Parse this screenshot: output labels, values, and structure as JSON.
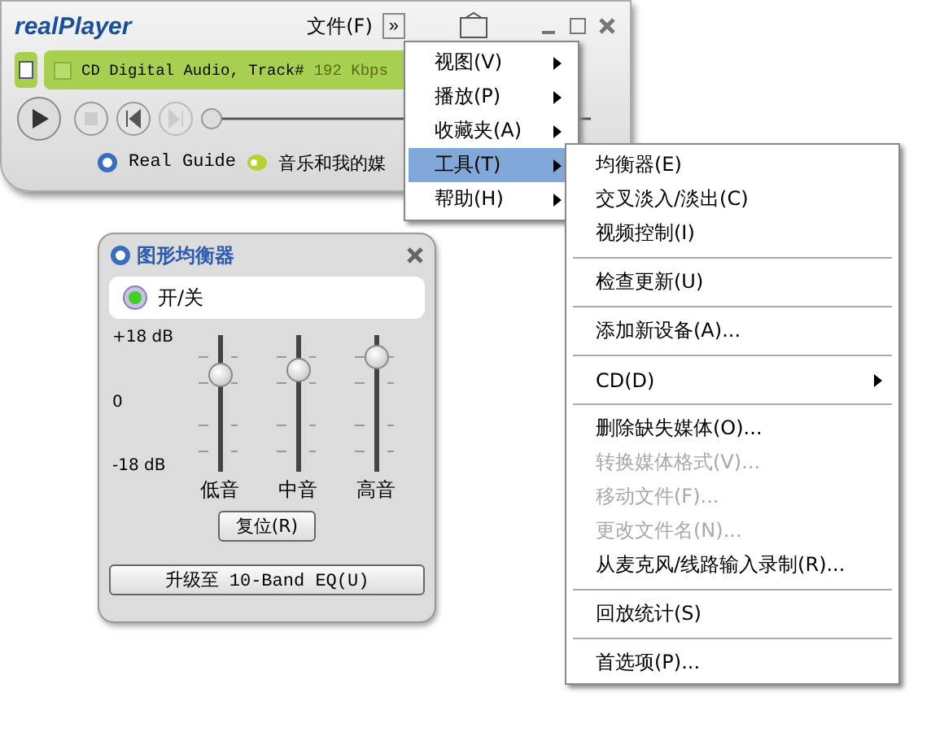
{
  "player": {
    "logo": "realPlayer",
    "file_menu": "文件(F)",
    "more_button": "»",
    "display": {
      "title": "CD Digital Audio, Track#",
      "bitrate": "192 Kbps"
    },
    "position": {
      "level": 0
    },
    "links": [
      {
        "label": "Real Guide"
      },
      {
        "label": "音乐和我的媒"
      }
    ]
  },
  "menu": {
    "items": [
      {
        "label": "视图(V)",
        "selected": false,
        "has_submenu": true
      },
      {
        "label": "播放(P)",
        "selected": false,
        "has_submenu": true
      },
      {
        "label": "收藏夹(A)",
        "selected": false,
        "has_submenu": true
      },
      {
        "label": "工具(T)",
        "selected": true,
        "has_submenu": true
      },
      {
        "label": "帮助(H)",
        "selected": false,
        "has_submenu": true
      }
    ]
  },
  "submenu": {
    "groups": [
      {
        "items": [
          {
            "label": "均衡器(E)",
            "disabled": false,
            "has_submenu": false
          },
          {
            "label": "交叉淡入/淡出(C)",
            "disabled": false,
            "has_submenu": false
          },
          {
            "label": "视频控制(I)",
            "disabled": false,
            "has_submenu": false
          }
        ]
      },
      {
        "items": [
          {
            "label": "检查更新(U)",
            "disabled": false,
            "has_submenu": false
          }
        ]
      },
      {
        "items": [
          {
            "label": "添加新设备(A)...",
            "disabled": false,
            "has_submenu": false
          }
        ]
      },
      {
        "items": [
          {
            "label": "CD(D)",
            "disabled": false,
            "has_submenu": true
          }
        ]
      },
      {
        "items": [
          {
            "label": "删除缺失媒体(O)...",
            "disabled": false,
            "has_submenu": false
          },
          {
            "label": "转换媒体格式(V)...",
            "disabled": true,
            "has_submenu": false
          },
          {
            "label": "移动文件(F)...",
            "disabled": true,
            "has_submenu": false
          },
          {
            "label": "更改文件名(N)...",
            "disabled": true,
            "has_submenu": false
          },
          {
            "label": "从麦克风/线路输入录制(R)...",
            "disabled": false,
            "has_submenu": false
          }
        ]
      },
      {
        "items": [
          {
            "label": "回放统计(S)",
            "disabled": false,
            "has_submenu": false
          }
        ]
      },
      {
        "items": [
          {
            "label": "首选项(P)...",
            "disabled": false,
            "has_submenu": false
          }
        ]
      }
    ]
  },
  "equalizer": {
    "title": "图形均衡器",
    "power": {
      "label": "开/关",
      "on": true
    },
    "scale": [
      "+18 dB",
      "0",
      "-18 dB"
    ],
    "bands": [
      {
        "label": "低音",
        "level": 0.65
      },
      {
        "label": "中音",
        "level": 0.69
      },
      {
        "label": "高音",
        "level": 0.78
      }
    ],
    "reset_button": "复位(R)",
    "upgrade_button": "升级至 10-Band EQ(U)"
  }
}
